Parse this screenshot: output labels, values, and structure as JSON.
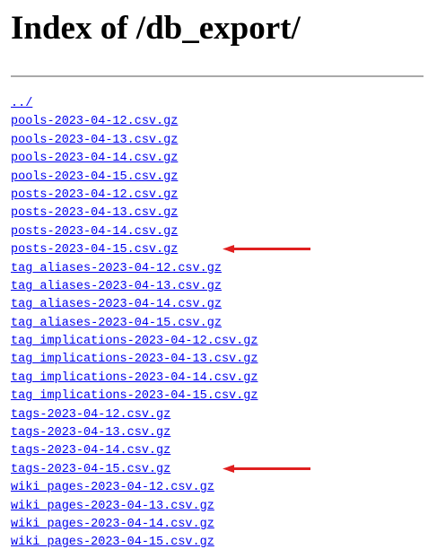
{
  "page": {
    "title": "Index of /db_export/"
  },
  "listing": {
    "entries": [
      "../",
      "pools-2023-04-12.csv.gz",
      "pools-2023-04-13.csv.gz",
      "pools-2023-04-14.csv.gz",
      "pools-2023-04-15.csv.gz",
      "posts-2023-04-12.csv.gz",
      "posts-2023-04-13.csv.gz",
      "posts-2023-04-14.csv.gz",
      "posts-2023-04-15.csv.gz",
      "tag_aliases-2023-04-12.csv.gz",
      "tag_aliases-2023-04-13.csv.gz",
      "tag_aliases-2023-04-14.csv.gz",
      "tag_aliases-2023-04-15.csv.gz",
      "tag_implications-2023-04-12.csv.gz",
      "tag_implications-2023-04-13.csv.gz",
      "tag_implications-2023-04-14.csv.gz",
      "tag_implications-2023-04-15.csv.gz",
      "tags-2023-04-12.csv.gz",
      "tags-2023-04-13.csv.gz",
      "tags-2023-04-14.csv.gz",
      "tags-2023-04-15.csv.gz",
      "wiki_pages-2023-04-12.csv.gz",
      "wiki_pages-2023-04-13.csv.gz",
      "wiki_pages-2023-04-14.csv.gz",
      "wiki_pages-2023-04-15.csv.gz"
    ]
  },
  "annotations": {
    "arrow_color": "#e02020",
    "link_color": "#0000ee",
    "highlighted_entries": [
      "posts-2023-04-15.csv.gz",
      "tags-2023-04-15.csv.gz"
    ]
  }
}
